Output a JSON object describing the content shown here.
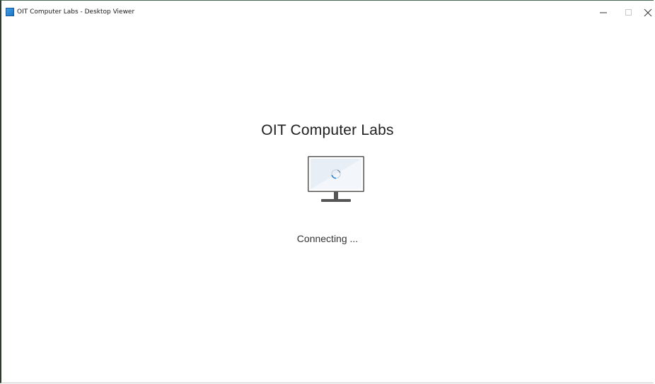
{
  "window": {
    "title": "OIT Computer Labs - Desktop Viewer",
    "icon": "app-icon"
  },
  "caption_buttons": {
    "minimize": "minimize-icon",
    "maximize": "maximize-icon",
    "close": "close-icon"
  },
  "main": {
    "heading": "OIT Computer Labs",
    "status": "Connecting ...",
    "illustration": "monitor-icon",
    "spinner": "loading-spinner-icon"
  },
  "colors": {
    "accent": "#2a82d4",
    "monitor_frame": "#555555",
    "monitor_screen": "#e8eef6"
  }
}
